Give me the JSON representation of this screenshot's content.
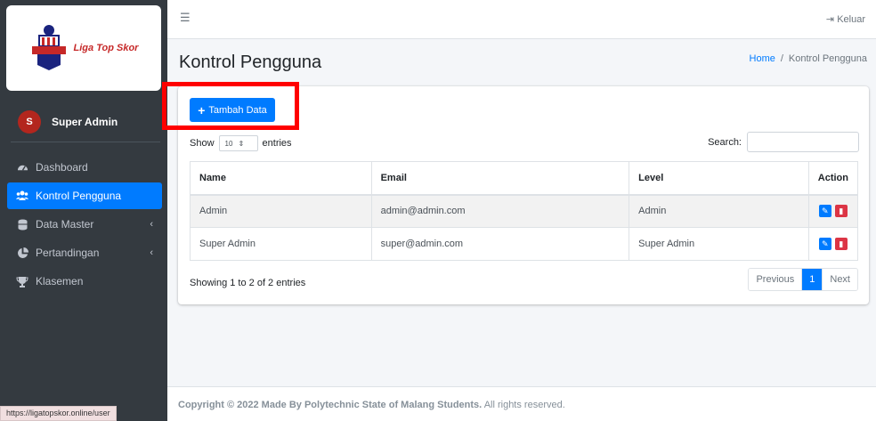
{
  "brand": {
    "name": "Liga Top Skor",
    "logo_text": "LIGA TOPSKOR"
  },
  "user": {
    "initial": "S",
    "name": "Super Admin"
  },
  "nav": [
    {
      "label": "Dashboard",
      "icon": "dashboard-icon",
      "active": false
    },
    {
      "label": "Kontrol Pengguna",
      "icon": "users-icon",
      "active": true
    },
    {
      "label": "Data Master",
      "icon": "database-icon",
      "active": false,
      "chevron": true
    },
    {
      "label": "Pertandingan",
      "icon": "pie-chart-icon",
      "active": false,
      "chevron": true
    },
    {
      "label": "Klasemen",
      "icon": "trophy-icon",
      "active": false
    }
  ],
  "topbar": {
    "logout_label": "Keluar"
  },
  "page": {
    "title": "Kontrol Pengguna"
  },
  "breadcrumb": {
    "home": "Home",
    "current": "Kontrol Pengguna"
  },
  "toolbar": {
    "add_label": "Tambah Data"
  },
  "datatable": {
    "show_label": "Show",
    "entries_value": "10",
    "entries_label": "entries",
    "search_label": "Search:",
    "columns": [
      "Name",
      "Email",
      "Level",
      "Action"
    ],
    "rows": [
      {
        "name": "Admin",
        "email": "admin@admin.com",
        "level": "Admin"
      },
      {
        "name": "Super Admin",
        "email": "super@admin.com",
        "level": "Super Admin"
      }
    ],
    "info": "Showing 1 to 2 of 2 entries",
    "pagination": {
      "previous": "Previous",
      "page": "1",
      "next": "Next"
    }
  },
  "footer": {
    "copyright": "Copyright © 2022 Made By Polytechnic State of Malang Students.",
    "rights": "All rights reserved."
  },
  "status_bar": {
    "url": "https://ligatopskor.online/user"
  },
  "colors": {
    "primary": "#007bff",
    "sidebar": "#343a40",
    "danger": "#dc3545",
    "highlight": "#ff0000"
  }
}
